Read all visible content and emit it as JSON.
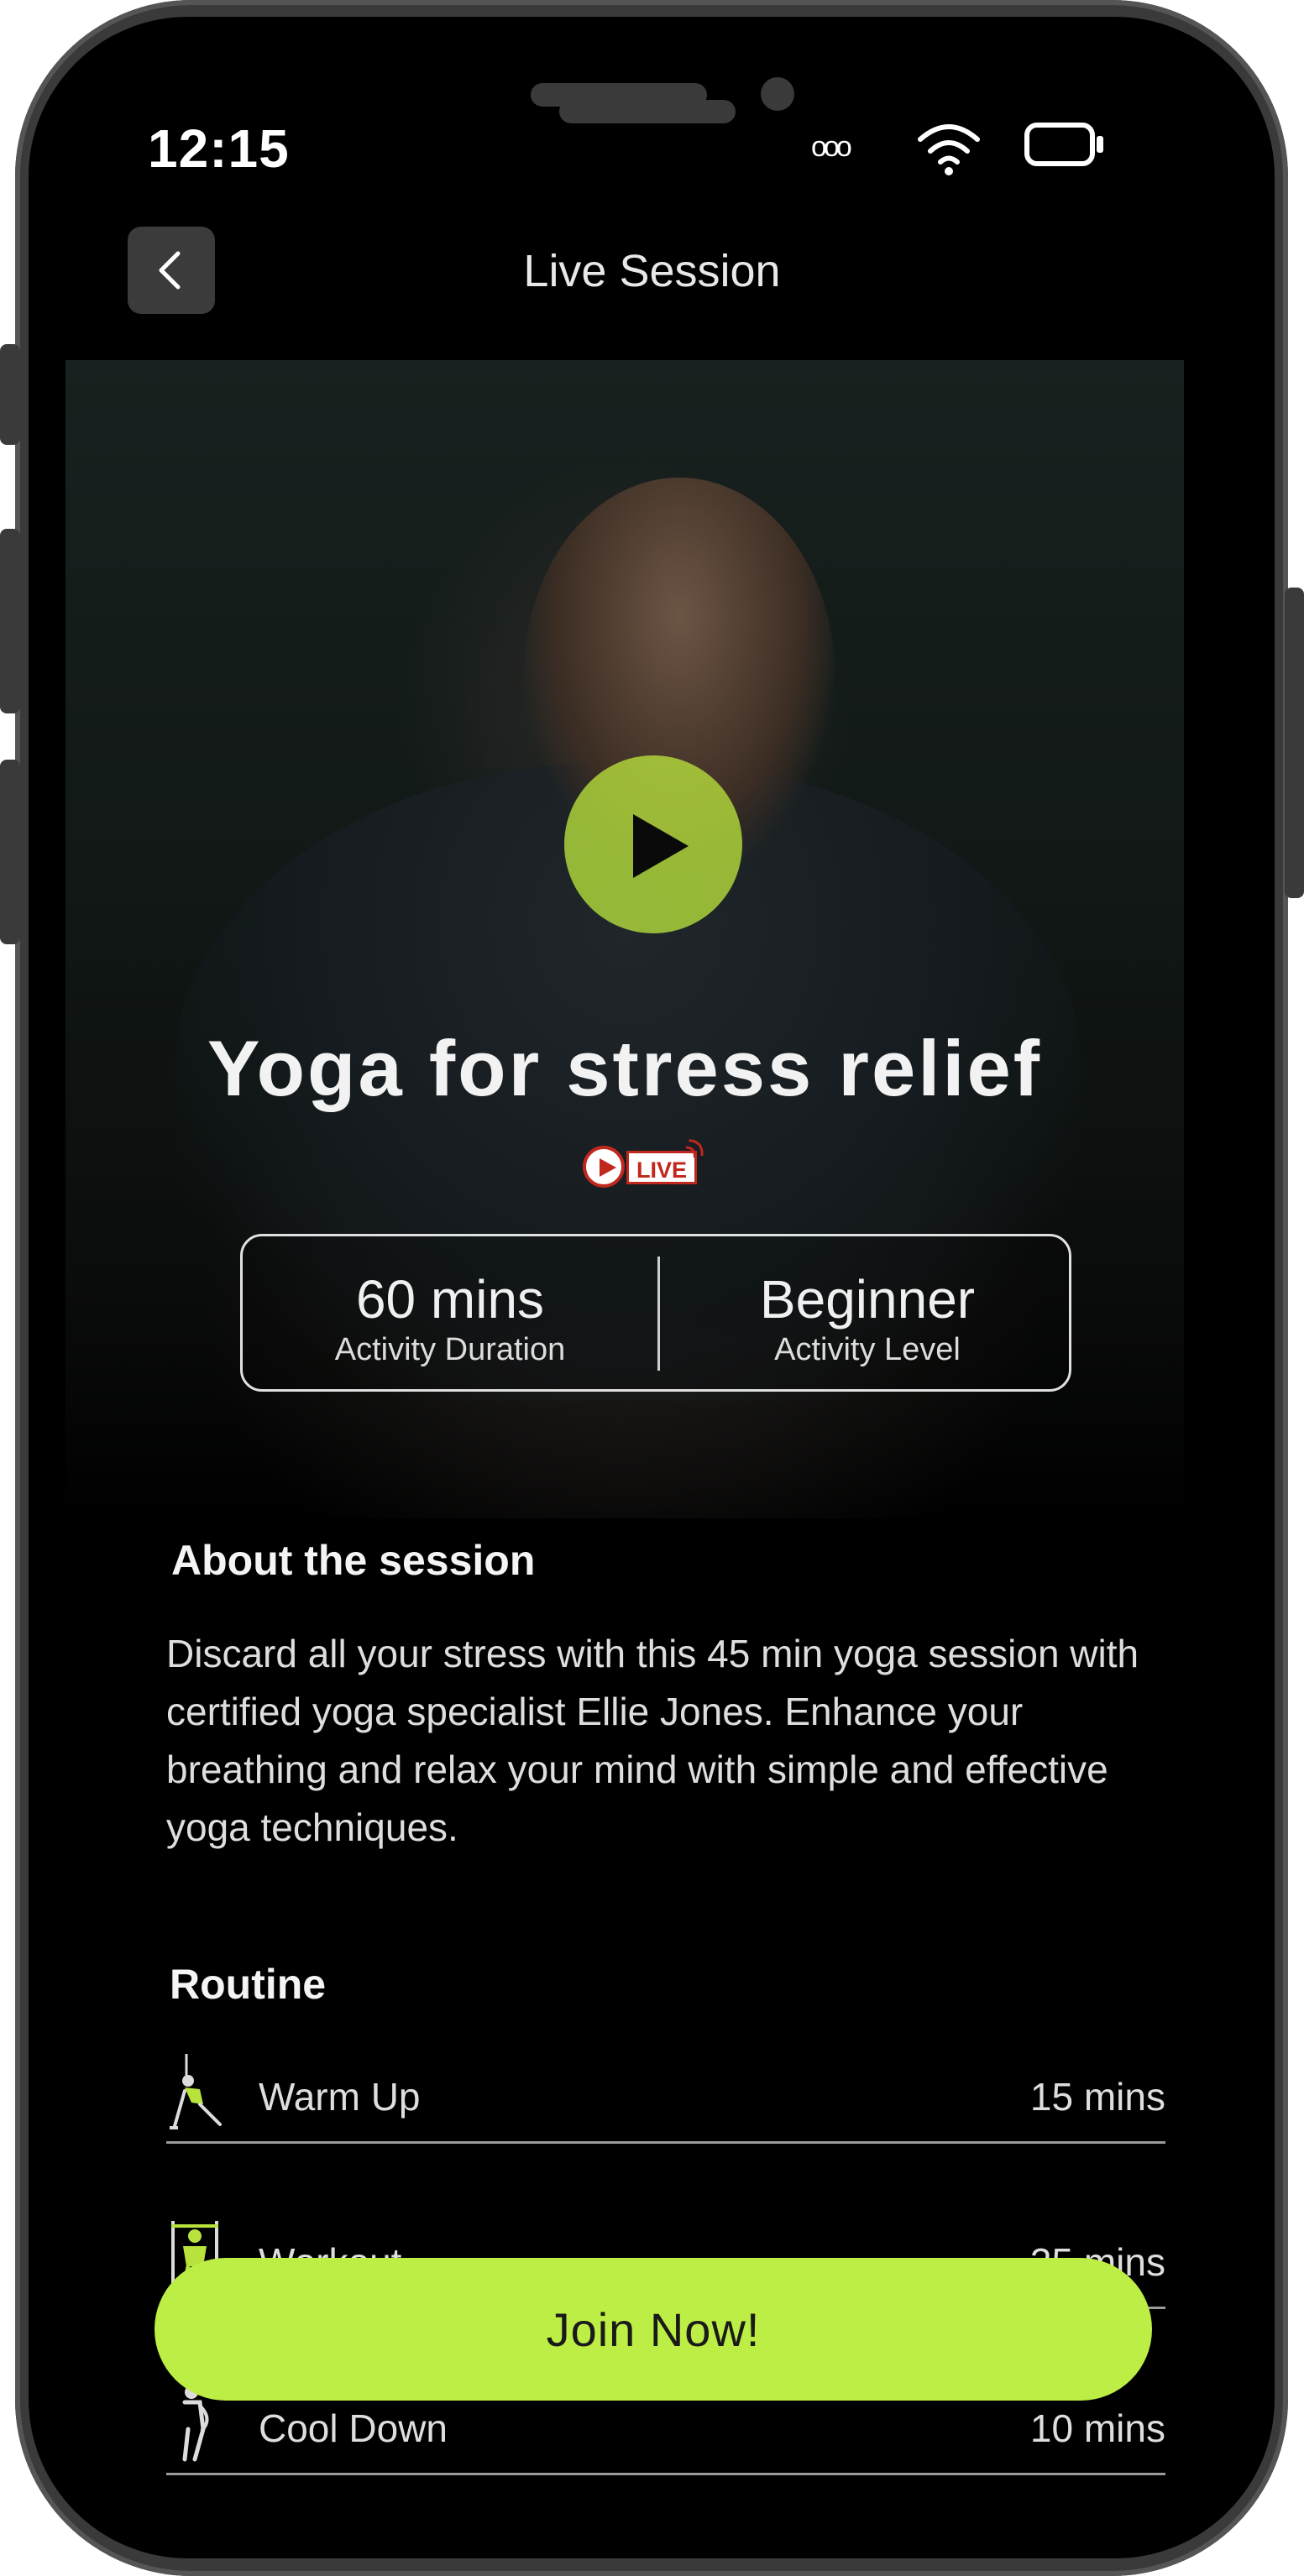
{
  "status_bar": {
    "time": "12:15",
    "signal": "ooo"
  },
  "nav": {
    "title": "Live Session"
  },
  "hero": {
    "title": "Yoga for stress relief",
    "live_label": "LIVE",
    "stats": [
      {
        "value": "60 mins",
        "label": "Activity Duration"
      },
      {
        "value": "Beginner",
        "label": "Activity Level"
      }
    ]
  },
  "about": {
    "heading": "About the session",
    "text": "Discard all your stress with this 45 min yoga session with certified yoga specialist Ellie Jones. Enhance your breathing and relax your mind with simple and effective yoga techniques."
  },
  "routine": {
    "heading": "Routine",
    "items": [
      {
        "name": "Warm Up",
        "duration": "15 mins",
        "icon": "warm-up-pose-icon"
      },
      {
        "name": "Workout",
        "duration": "35 mins",
        "icon": "workout-figure-icon"
      },
      {
        "name": "Cool Down",
        "duration": "10 mins",
        "icon": "cool-down-figure-icon"
      }
    ]
  },
  "cta": {
    "label": "Join Now!"
  },
  "colors": {
    "accent": "#bdee45",
    "background": "#000000",
    "live_red": "#c0281e"
  }
}
